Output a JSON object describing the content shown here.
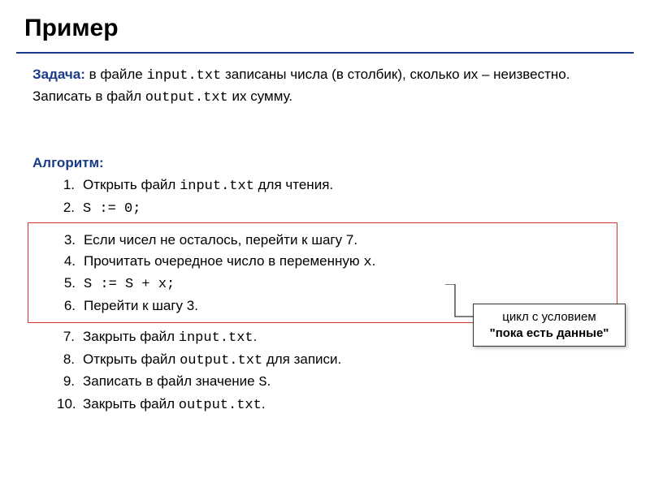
{
  "title": "Пример",
  "task": {
    "label": "Задача:",
    "part1": " в файле ",
    "file1": "input.txt",
    "part2": " записаны числа (в столбик), сколько их – неизвестно. Записать в файл ",
    "file2": "output.txt",
    "part3": " их сумму."
  },
  "algo_label": "Алгоритм:",
  "steps_top": [
    {
      "n": "1.",
      "t_pre": "Открыть файл ",
      "t_code": "input.txt",
      "t_post": " для чтения."
    },
    {
      "n": "2.",
      "t_pre": "",
      "t_code": "S := 0;",
      "t_post": ""
    }
  ],
  "steps_box": [
    {
      "n": "3.",
      "t_pre": "Если чисел не осталось, перейти к шагу 7.",
      "t_code": "",
      "t_post": ""
    },
    {
      "n": "4.",
      "t_pre": "Прочитать очередное число в переменную ",
      "t_code": "x",
      "t_post": "."
    },
    {
      "n": "5.",
      "t_pre": "",
      "t_code": "S := S + x;",
      "t_post": ""
    },
    {
      "n": "6.",
      "t_pre": "Перейти к шагу 3.",
      "t_code": "",
      "t_post": ""
    }
  ],
  "steps_bottom": [
    {
      "n": "7.",
      "t_pre": "Закрыть файл ",
      "t_code": "input.txt",
      "t_post": "."
    },
    {
      "n": "8.",
      "t_pre": "Открыть файл ",
      "t_code": "output.txt",
      "t_post": " для записи."
    },
    {
      "n": "9.",
      "t_pre": "Записать в файл значение ",
      "t_code": "S",
      "t_post": "."
    },
    {
      "n": "10.",
      "t_pre": "Закрыть файл ",
      "t_code": "output.txt",
      "t_post": "."
    }
  ],
  "callout": {
    "line1": "цикл с условием",
    "line2": "\"пока есть данные\""
  }
}
